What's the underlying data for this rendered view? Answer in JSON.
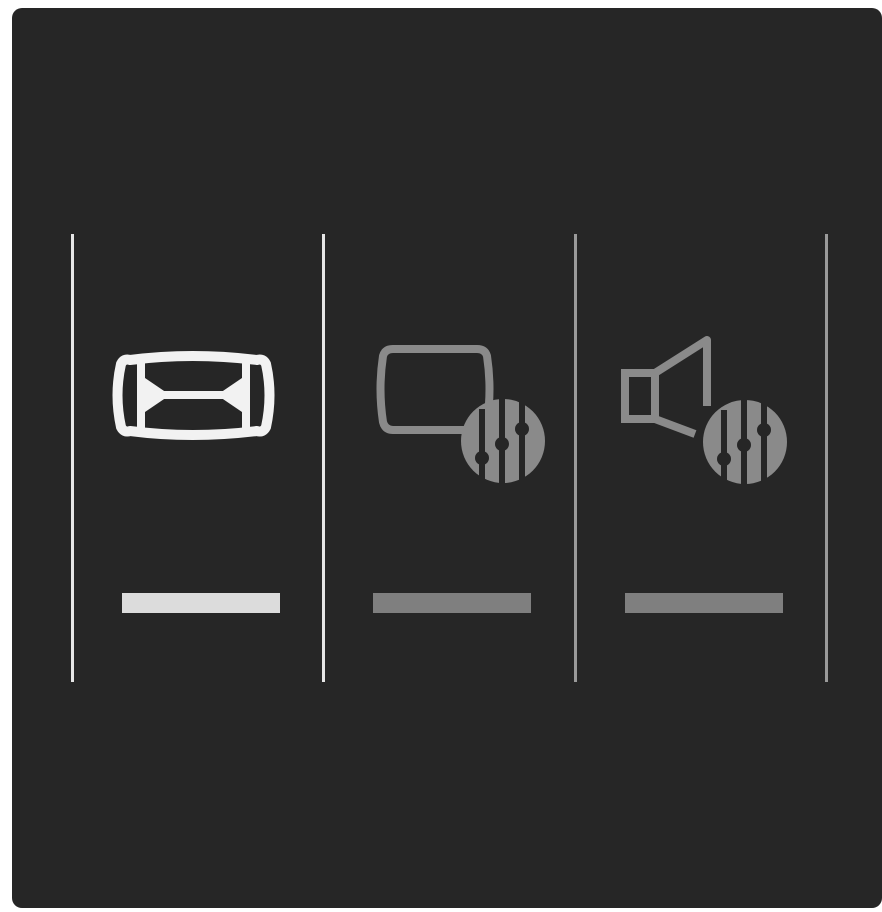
{
  "menu": {
    "items": [
      {
        "id": "picture-format",
        "icon": "picture-format-icon",
        "selected": true
      },
      {
        "id": "picture-settings",
        "icon": "picture-settings-icon",
        "selected": false
      },
      {
        "id": "sound-settings",
        "icon": "sound-settings-icon",
        "selected": false
      }
    ],
    "selected_index": 0
  },
  "colors": {
    "background": "#262626",
    "active": "#f2f2f2",
    "active_bar": "#dcdcdc",
    "inactive": "#8a8a8a",
    "inactive_bar": "#7f7f7f",
    "divider_bright": "#e6e6e6",
    "divider_dim": "#9a9a9a"
  }
}
